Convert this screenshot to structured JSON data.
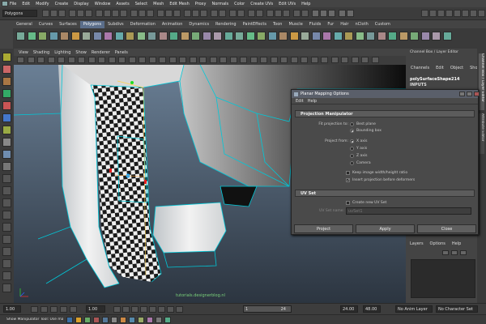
{
  "menubar": {
    "items": [
      "File",
      "Edit",
      "Modify",
      "Create",
      "Display",
      "Window",
      "Assets",
      "Select",
      "Mesh",
      "Edit Mesh",
      "Proxy",
      "Normals",
      "Color",
      "Create UVs",
      "Edit UVs",
      "Help"
    ]
  },
  "statusline": {
    "mode": "Polygons"
  },
  "shelf": {
    "tabs": [
      "General",
      "Curves",
      "Surfaces",
      "Polygons",
      "Subdivs",
      "Deformation",
      "Animation",
      "Dynamics",
      "Rendering",
      "PaintEffects",
      "Toon",
      "Muscle",
      "Fluids",
      "Fur",
      "Hair",
      "nCloth",
      "Custom"
    ],
    "active_tab": "Polygons"
  },
  "panel": {
    "menus": [
      "View",
      "Shading",
      "Lighting",
      "Show",
      "Renderer",
      "Panels"
    ],
    "watermark": "tutorials.designerblog.nl"
  },
  "channel_box": {
    "title": "Channel Box / Layer Editor",
    "menus": [
      "Channels",
      "Edit",
      "Object",
      "Show"
    ],
    "node_name": "polySurfaceShape214",
    "inputs_label": "INPUTS",
    "side_tabs": [
      "Channel Box / Layer Editor",
      "Attribute Editor"
    ]
  },
  "layer_editor": {
    "menus": [
      "Layers",
      "Options",
      "Help"
    ]
  },
  "dialog": {
    "title": "Planar Mapping Options",
    "menus": [
      "Edit",
      "Help"
    ],
    "projection_section": "Projection Manipulator",
    "fit_label": "Fit projection to:",
    "fit_options": [
      "Best plane",
      "Bounding box"
    ],
    "fit_selected": "Bounding box",
    "project_from_label": "Project from:",
    "project_from_options": [
      "X axis",
      "Y axis",
      "Z axis",
      "Camera"
    ],
    "project_from_selected": "X axis",
    "keep_ratio_label": "Keep image width/height ratio",
    "keep_ratio_checked": false,
    "insert_before_label": "Insert projection before deformers",
    "insert_before_checked": true,
    "uv_section": "UV Set",
    "create_uv_label": "Create new UV Set",
    "create_uv_checked": false,
    "uv_set_name_label": "UV Set name:",
    "uv_set_name_value": "uvSet1",
    "buttons": {
      "project": "Project",
      "apply": "Apply",
      "close": "Close"
    }
  },
  "timeline": {
    "start_field": "1.00",
    "current_field": "1.00",
    "range_start": "1",
    "range_end": "24",
    "end_field": "24.00",
    "end_max_field": "48.00",
    "anim_layer": "No Anim Layer",
    "character_set": "No Character Set"
  },
  "helpline": {
    "text": "Show Manipulator Tool: Use manipulator to edit attributes"
  },
  "colors": {
    "viewport_top": "#6a7f95",
    "viewport_bottom": "#2c3540",
    "wireframe": "#00c8d8",
    "accent": "#5b6e8a"
  }
}
